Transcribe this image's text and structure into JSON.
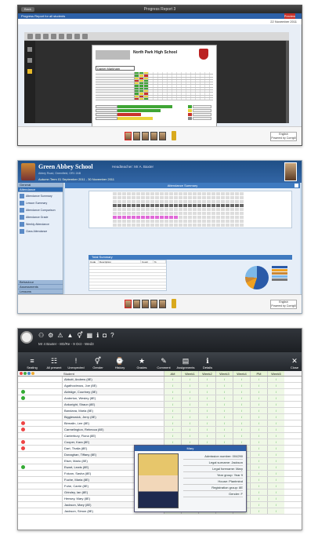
{
  "panel1": {
    "title": "Progress Report 3",
    "back_label": "Back",
    "subbar_left": "Progress Report for all students",
    "subbar_right": "Preview",
    "date": "22 November 2011",
    "school_name": "North Park High School",
    "student_label": "Daniel Markham",
    "language": "English",
    "language_sub": "Powered by Corrigill"
  },
  "panel2": {
    "school": "Green Abbey School",
    "headteacher": "Headteacher: Mr A. Baxter",
    "address": "Abbey Road, Greenfield, GR1 2AB",
    "period": "Autumn Term 01 September 2011 - 30 November 2011",
    "sidebar_header": "General",
    "sidebar_section": "Attendance",
    "sidebar_items": [
      "Attendance Summary",
      "Lesson Summary",
      "Attendance Comparison",
      "Attendance Grade",
      "Weekly Attendance",
      "Class Attendance"
    ],
    "sidebar_bottom": [
      "Behaviour",
      "Assessments",
      "Lessons"
    ],
    "main_title": "Attendance Summary",
    "summary_title": "Total Summary",
    "table_headers": [
      "Code",
      "Description",
      "Count",
      "%"
    ],
    "language": "English",
    "language_sub": "Powered by Corrigill"
  },
  "panel3": {
    "class_label": "Mr 4 Baxter - 8G/Re - 9 Oct - Wed3",
    "tools": [
      {
        "icon": "≡",
        "label": "Seating"
      },
      {
        "icon": "☷",
        "label": "All present"
      },
      {
        "icon": "!",
        "label": "Unexpected"
      },
      {
        "icon": "⚥",
        "label": "Gender"
      },
      {
        "icon": "⌚",
        "label": "History"
      },
      {
        "icon": "★",
        "label": "Grades"
      },
      {
        "icon": "✎",
        "label": "Comment"
      },
      {
        "icon": "▤",
        "label": "Assignments"
      },
      {
        "icon": "ℹ",
        "label": "Details"
      }
    ],
    "close_label": "Close",
    "student_header": "Student",
    "week_headers": [
      "AM",
      "Week1",
      "Week2",
      "Week3",
      "Week4",
      "PM",
      "Week5"
    ],
    "students": [
      {
        "name": "Abbott, Andrew (8E)",
        "mark": "/"
      },
      {
        "name": "Agathocleous, Joe (8E)",
        "mark": "/"
      },
      {
        "name": "Aldridge, Courtney (8E)",
        "mark": "/"
      },
      {
        "name": "Anderton, Wesley (8E)",
        "mark": "/"
      },
      {
        "name": "Ankoright, Shaun (8E)",
        "mark": "/"
      },
      {
        "name": "Bandana, Maria (8E)",
        "mark": "/"
      },
      {
        "name": "Biggleswick, Jerry (8E)",
        "mark": "/"
      },
      {
        "name": "Birmalin, Lee (8E)",
        "mark": "/"
      },
      {
        "name": "Carmelington, Rebecca (8E)",
        "mark": "/"
      },
      {
        "name": "Canterbury, Fiona (8E)",
        "mark": "/"
      },
      {
        "name": "Cooper, Kara (8E)",
        "mark": "/"
      },
      {
        "name": "Dart, Thalia (8E)",
        "mark": "/"
      },
      {
        "name": "Donaghan, Tiffany (8E)",
        "mark": "/"
      },
      {
        "name": "Elser, Mario (8E)",
        "mark": "/"
      },
      {
        "name": "Ewart, Lewis (8E)",
        "mark": "/"
      },
      {
        "name": "Folcan, Sasha (8E)",
        "mark": "/"
      },
      {
        "name": "Fuche, Maria (8E)",
        "mark": "/"
      },
      {
        "name": "Fuhe, Carrie (8E)",
        "mark": "/"
      },
      {
        "name": "Grindey, Ian (8E)",
        "mark": "/"
      },
      {
        "name": "Hensey, Mary (8E)",
        "mark": "/"
      },
      {
        "name": "Jackson, Mary (8E)",
        "mark": "/"
      },
      {
        "name": "Jackson, Simon (8E)",
        "mark": "/"
      }
    ],
    "popup": {
      "title": "Mary",
      "fields": [
        "Admission number: 004290",
        "Legal surname: Jackson",
        "Legal forename: Mary",
        "Year group: Year 9",
        "House: Plantmind",
        "Registration group: 8E",
        "Gender: F"
      ]
    }
  }
}
